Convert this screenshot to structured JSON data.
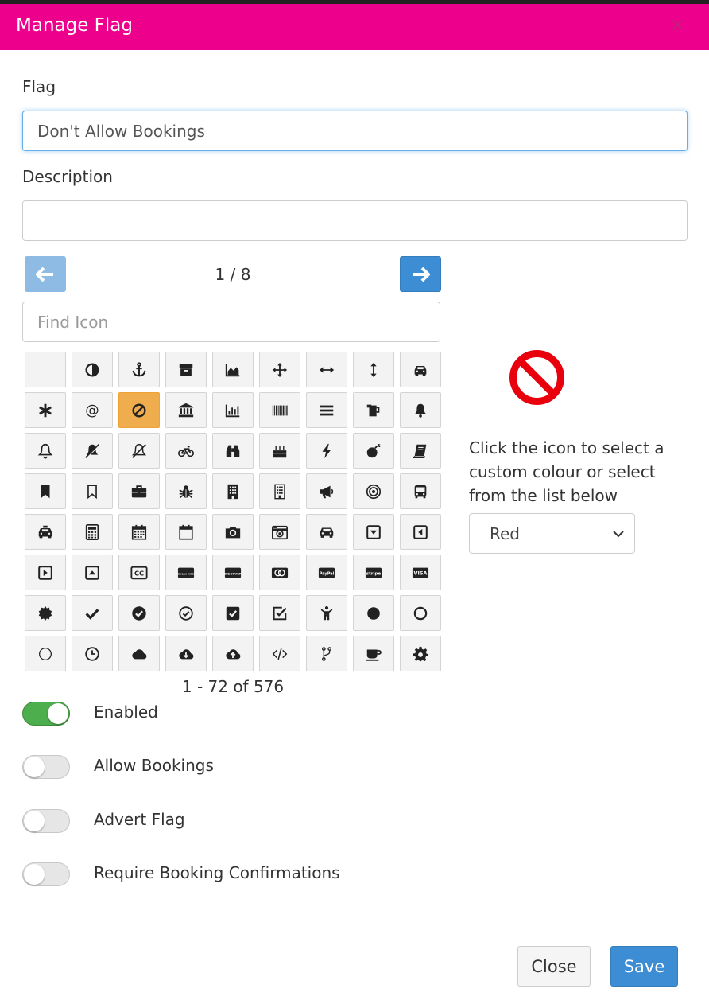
{
  "modal": {
    "title": "Manage Flag",
    "close_glyph": "×"
  },
  "form": {
    "flag_label": "Flag",
    "flag_value": "Don't Allow Bookings",
    "description_label": "Description",
    "description_value": ""
  },
  "icon_picker": {
    "page_indicator": "1 / 8",
    "prev_icon": "arrow-left-icon",
    "next_icon": "arrow-right-icon",
    "find_placeholder": "Find Icon",
    "count_text": "1 - 72 of 576",
    "selected_icon": "ban-icon",
    "rows": [
      [
        "blank-icon",
        "adjust-icon",
        "anchor-icon",
        "archive-icon",
        "area-chart-icon",
        "arrows-icon",
        "arrows-h-icon",
        "arrows-v-icon",
        "car-icon"
      ],
      [
        "asterisk-icon",
        "at-icon",
        "ban-icon",
        "bank-icon",
        "bar-chart-icon",
        "barcode-icon",
        "bars-icon",
        "beer-icon",
        "bell-icon"
      ],
      [
        "bell-outline-icon",
        "bell-slash-icon",
        "bell-slash-outline-icon",
        "bicycle-icon",
        "binoculars-icon",
        "birthday-cake-icon",
        "bolt-icon",
        "bomb-icon",
        "book-icon"
      ],
      [
        "bookmark-icon",
        "bookmark-outline-icon",
        "briefcase-icon",
        "bug-icon",
        "building-icon",
        "building-outline-icon",
        "bullhorn-icon",
        "bullseye-icon",
        "bus-icon"
      ],
      [
        "cab-icon",
        "calculator-icon",
        "calendar-icon",
        "calendar-outline-icon",
        "camera-icon",
        "camera-retro-icon",
        "car-front-icon",
        "caret-square-down-icon",
        "caret-square-left-icon"
      ],
      [
        "caret-square-right-icon",
        "caret-square-up-icon",
        "cc-icon",
        "cc-amex-icon",
        "cc-discover-icon",
        "cc-mastercard-icon",
        "cc-paypal-icon",
        "cc-stripe-icon",
        "cc-visa-icon"
      ],
      [
        "certificate-icon",
        "check-icon",
        "check-circle-icon",
        "check-circle-outline-icon",
        "check-square-icon",
        "check-square-outline-icon",
        "child-icon",
        "circle-icon",
        "circle-outline-icon"
      ],
      [
        "circle-thin-icon",
        "clock-icon",
        "cloud-icon",
        "cloud-download-icon",
        "cloud-upload-icon",
        "code-icon",
        "code-fork-icon",
        "coffee-icon",
        "cog-icon"
      ]
    ],
    "card_text": {
      "cc": "CC",
      "amex": "AMERICAN EXPRESS",
      "discover": "DISCOVER",
      "paypal": "PayPal",
      "stripe": "stripe",
      "visa": "VISA"
    }
  },
  "preview": {
    "icon": "ban-icon",
    "color": "#e8000d",
    "help_text": "Click the icon to select a custom colour or select from the list below",
    "colour_select_value": "Red"
  },
  "toggles": [
    {
      "label": "Enabled",
      "on": true
    },
    {
      "label": "Allow Bookings",
      "on": false
    },
    {
      "label": "Advert Flag",
      "on": false
    },
    {
      "label": "Require Booking Confirmations",
      "on": false
    }
  ],
  "footer": {
    "close_label": "Close",
    "save_label": "Save"
  },
  "colors": {
    "header": "#ec008c",
    "primary": "#3c8dd4",
    "selected_cell": "#f0ad4e",
    "toggle_on": "#4cae4c"
  }
}
